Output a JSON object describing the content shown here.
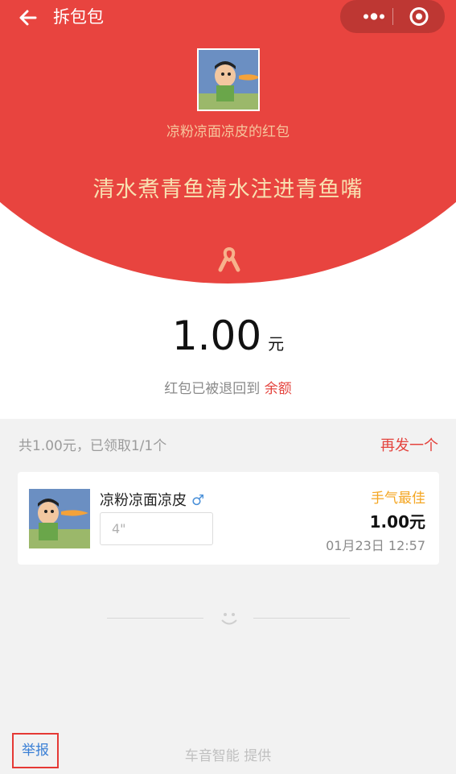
{
  "nav": {
    "title": "拆包包"
  },
  "packet": {
    "sender": "凉粉凉面凉皮的红包",
    "wish": "清水煮青鱼清水注进青鱼嘴",
    "amount": "1.00",
    "unit": "元",
    "refund_text": "红包已被退回到",
    "refund_link": "余额"
  },
  "summary": {
    "text": "共1.00元，已领取1/1个",
    "resend": "再发一个"
  },
  "record": {
    "name": "凉粉凉面凉皮",
    "gender_symbol": "♂",
    "voice": "4\"",
    "tag": "手气最佳",
    "money": "1.00元",
    "time": "01月23日 12:57"
  },
  "footer": {
    "report": "举报",
    "provider": "车音智能 提供"
  },
  "colors": {
    "red": "#e8443f",
    "gold": "#f8e0b0",
    "best": "#f4a623",
    "link": "#e4433d"
  }
}
